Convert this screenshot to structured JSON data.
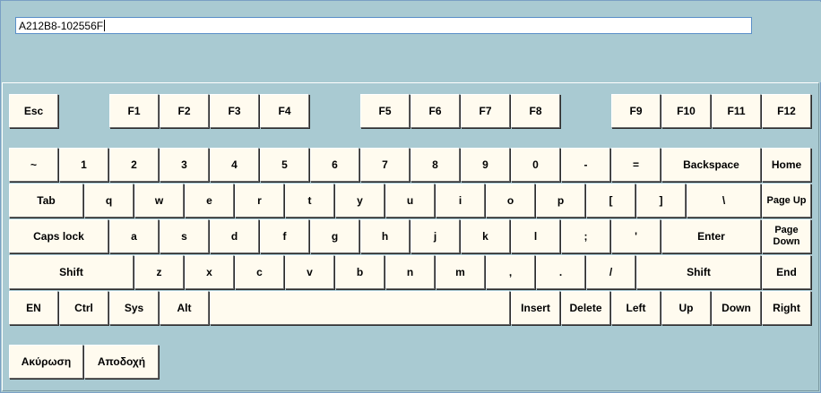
{
  "input": {
    "value": "A212B8-102556F"
  },
  "keys": {
    "esc": "Esc",
    "f1": "F1",
    "f2": "F2",
    "f3": "F3",
    "f4": "F4",
    "f5": "F5",
    "f6": "F6",
    "f7": "F7",
    "f8": "F8",
    "f9": "F9",
    "f10": "F10",
    "f11": "F11",
    "f12": "F12",
    "tilde": "~",
    "d1": "1",
    "d2": "2",
    "d3": "3",
    "d4": "4",
    "d5": "5",
    "d6": "6",
    "d7": "7",
    "d8": "8",
    "d9": "9",
    "d0": "0",
    "minus": "-",
    "equals": "=",
    "backspace": "Backspace",
    "home": "Home",
    "tab": "Tab",
    "q": "q",
    "w": "w",
    "e": "e",
    "r": "r",
    "t": "t",
    "y": "y",
    "u": "u",
    "i": "i",
    "o": "o",
    "p": "p",
    "lbracket": "[",
    "rbracket": "]",
    "backslash": "\\",
    "pageup": "Page Up",
    "capslock": "Caps lock",
    "a": "a",
    "s": "s",
    "d": "d",
    "f": "f",
    "g": "g",
    "h": "h",
    "j": "j",
    "k": "k",
    "l": "l",
    "semicolon": ";",
    "quote": "'",
    "enter": "Enter",
    "pagedown": "Page\nDown",
    "shift_left": "Shift",
    "z": "z",
    "x": "x",
    "c": "c",
    "v": "v",
    "b": "b",
    "n": "n",
    "m": "m",
    "comma": ",",
    "period": ".",
    "slash": "/",
    "shift_right": "Shift",
    "end": "End",
    "en": "EN",
    "ctrl": "Ctrl",
    "sys": "Sys",
    "alt": "Alt",
    "space": "",
    "insert": "Insert",
    "delete": "Delete",
    "left": "Left",
    "up": "Up",
    "down": "Down",
    "right": "Right"
  },
  "actions": {
    "cancel": "Ακύρωση",
    "accept": "Αποδοχή"
  }
}
